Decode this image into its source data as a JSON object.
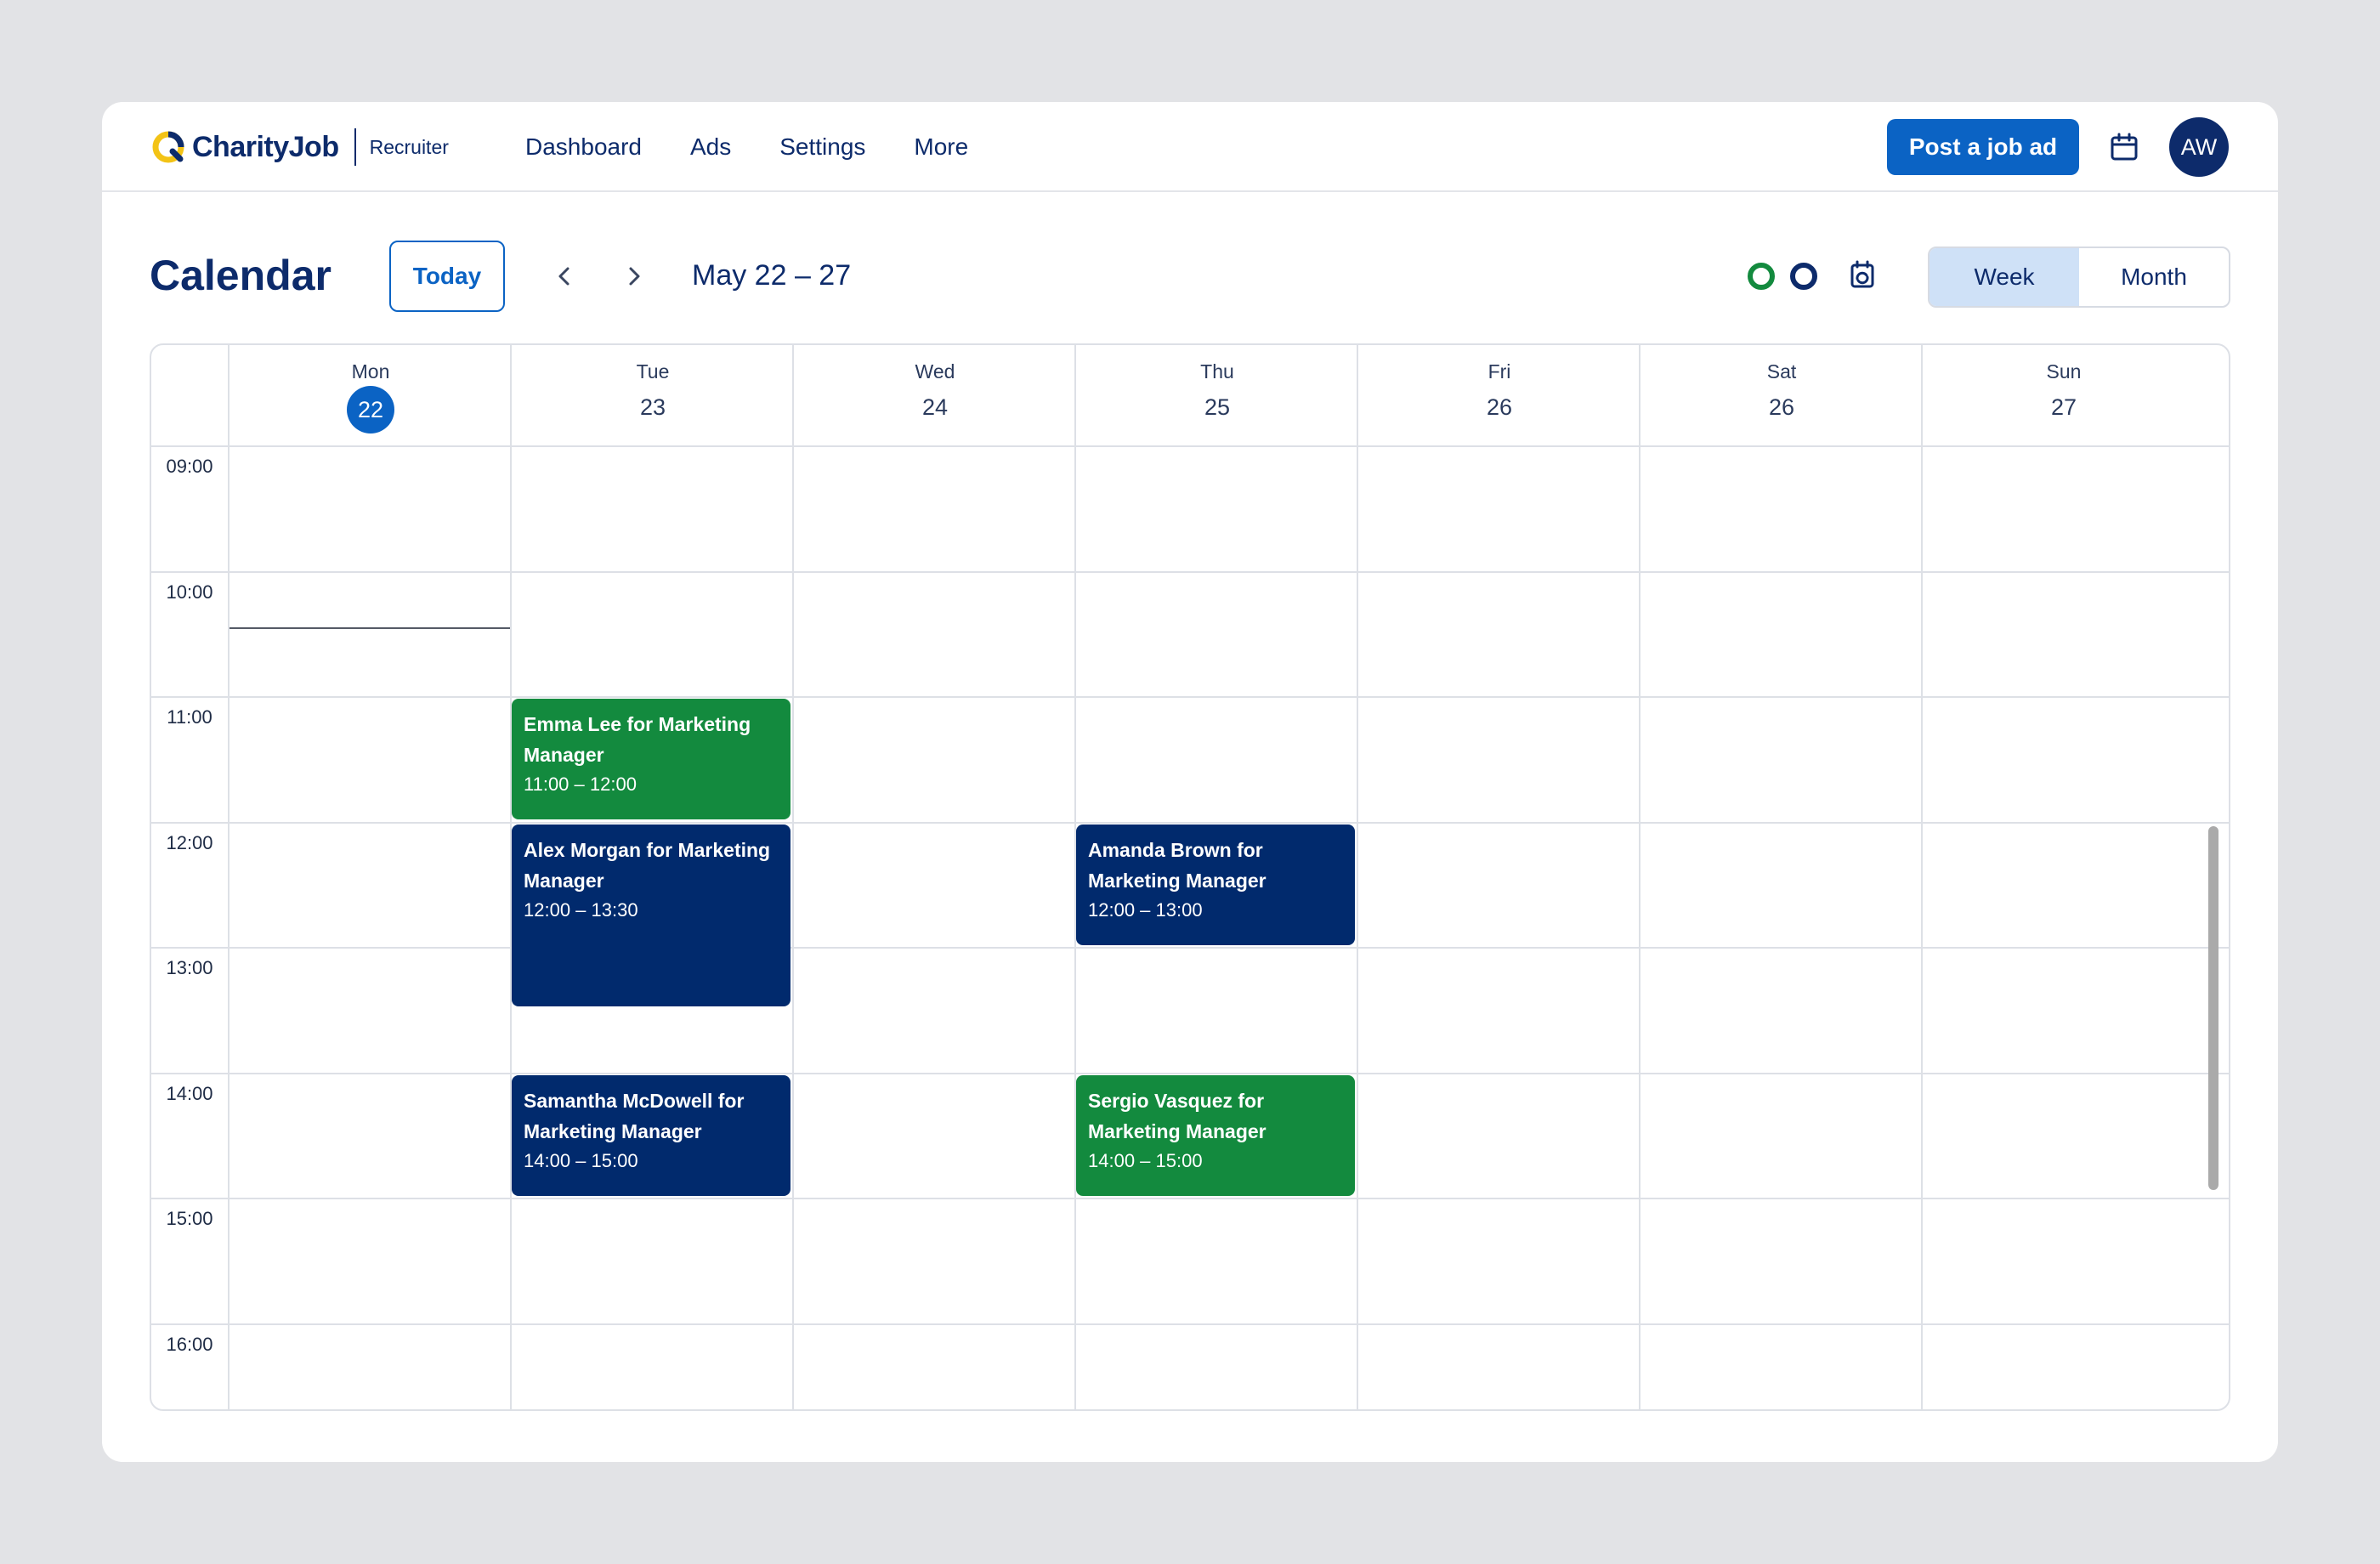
{
  "app": {
    "brand": "CharityJob",
    "brand_sub": "Recruiter",
    "nav": [
      "Dashboard",
      "Ads",
      "Settings",
      "More"
    ],
    "post_button": "Post a job ad",
    "avatar_initials": "AW"
  },
  "calendar": {
    "title": "Calendar",
    "today_button": "Today",
    "date_range": "May 22 – 27",
    "views": [
      "Week",
      "Month"
    ],
    "active_view": "Week",
    "legend_colors": [
      "#138a3e",
      "#0d2b6b"
    ],
    "days": [
      {
        "name": "Mon",
        "num": "22",
        "today": true
      },
      {
        "name": "Tue",
        "num": "23"
      },
      {
        "name": "Wed",
        "num": "24"
      },
      {
        "name": "Thu",
        "num": "25"
      },
      {
        "name": "Fri",
        "num": "26"
      },
      {
        "name": "Sat",
        "num": "26"
      },
      {
        "name": "Sun",
        "num": "27"
      }
    ],
    "times": [
      "09:00",
      "10:00",
      "11:00",
      "12:00",
      "13:00",
      "14:00",
      "15:00",
      "16:00"
    ],
    "events": [
      {
        "title": "Emma Lee for Marketing Manager",
        "time": "11:00 – 12:00",
        "color": "green"
      },
      {
        "title": "Alex Morgan for Marketing Manager",
        "time": "12:00 – 13:30",
        "color": "navy"
      },
      {
        "title": "Samantha McDowell for Marketing Manager",
        "time": "14:00 – 15:00",
        "color": "navy"
      },
      {
        "title": "Amanda Brown for Marketing Manager",
        "time": "12:00 – 13:00",
        "color": "navy"
      },
      {
        "title": "Sergio Vasquez for Marketing Manager",
        "time": "14:00 – 15:00",
        "color": "green"
      }
    ]
  }
}
